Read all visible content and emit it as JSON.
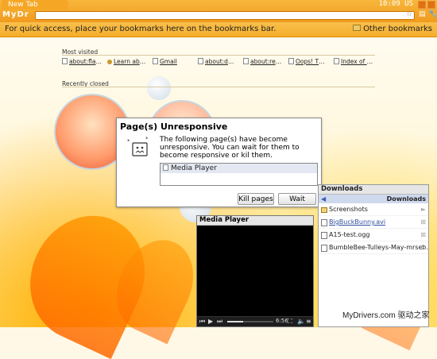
{
  "browser": {
    "tab_title": "New Tab",
    "brand": "MyDr",
    "clock": "10:09 US",
    "address_value": "",
    "bookmark_bar_message": "For quick access, place your bookmarks here on the bookmarks bar.",
    "other_bookmarks": "Other bookmarks"
  },
  "new_tab": {
    "most_visited_title": "Most visited",
    "most_visited": [
      {
        "label": "about:flags",
        "icon": "page-icon"
      },
      {
        "label": "Learn abo...",
        "icon": "globe-icon"
      },
      {
        "label": "Gmail",
        "icon": "page-icon"
      },
      {
        "label": "about:deb...",
        "icon": "page-icon"
      },
      {
        "label": "about:rem...",
        "icon": "page-icon"
      },
      {
        "label": "Oops! This...",
        "icon": "page-icon"
      },
      {
        "label": "Index of /...",
        "icon": "page-icon"
      }
    ],
    "recently_closed_title": "Recently closed"
  },
  "dialog": {
    "title": "Page(s) Unresponsive",
    "message": "The following page(s) have become unresponsive. You can wait for them to become responsive or kil them.",
    "pages": [
      "Media Player"
    ],
    "kill_label": "Kill pages",
    "wait_label": "Wait"
  },
  "downloads": {
    "title": "Downloads",
    "nav_label": "Downloads",
    "items": [
      {
        "label": "Screenshots",
        "type": "folder",
        "trail": "►"
      },
      {
        "label": "BigBuckBunny.avi",
        "type": "link",
        "trail": "⊠"
      },
      {
        "label": "A15-test.ogg",
        "type": "file",
        "trail": "⊠"
      },
      {
        "label": "BumbleBee-Tulleys-May-mrseb...",
        "type": "file",
        "trail": "⊠"
      }
    ]
  },
  "media_player": {
    "title": "Media Player",
    "time": "6:56",
    "progress": 0.35
  },
  "watermark": "MyDrivers.com 驱动之家",
  "colors": {
    "toolbar": "#f19a1e",
    "bookmark_bar": "#f5ae2c",
    "dialog_selection": "#e3e8f2",
    "downloads_nav": "#cfd9ee"
  }
}
